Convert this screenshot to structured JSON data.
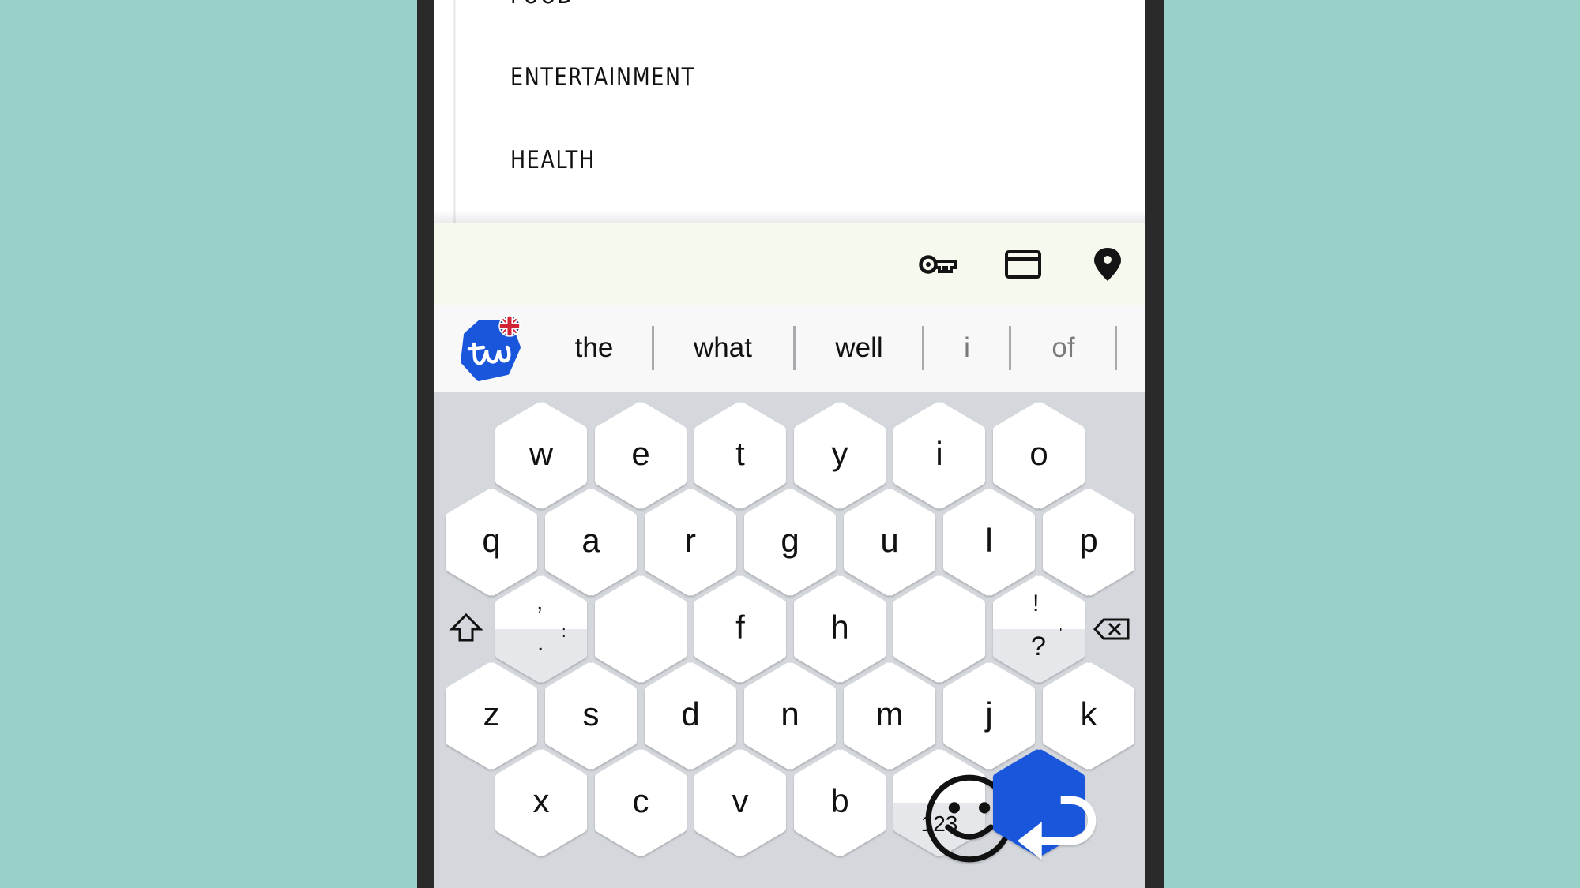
{
  "menu": {
    "items": [
      {
        "label": "FOOD"
      },
      {
        "label": "ENTERTAINMENT"
      },
      {
        "label": "HEALTH"
      }
    ]
  },
  "autofill": {
    "icons": [
      "key-icon",
      "credit-card-icon",
      "location-pin-icon"
    ]
  },
  "predictions": {
    "logo_text": "tw",
    "language_flag": "uk-flag",
    "suggestions": [
      {
        "text": "the",
        "dim": false
      },
      {
        "text": "what",
        "dim": false
      },
      {
        "text": "well",
        "dim": false
      },
      {
        "text": "i",
        "dim": true
      },
      {
        "text": "of",
        "dim": true
      }
    ]
  },
  "keyboard": {
    "rows": [
      [
        "w",
        "e",
        "t",
        "y",
        "i",
        "o"
      ],
      [
        "q",
        "a",
        "r",
        "g",
        "u",
        "l",
        "p"
      ],
      [
        "",
        "",
        "f",
        "h",
        "",
        ""
      ],
      [
        "z",
        "s",
        "d",
        "n",
        "m",
        "j",
        "k"
      ],
      [
        "x",
        "c",
        "v",
        "b"
      ]
    ],
    "punct_key": {
      "top": ",",
      "bottom": ".",
      "bottom_alt": ":"
    },
    "excl_key": {
      "top": "!",
      "bottom": "?",
      "bottom_alt": "'"
    },
    "emoji_key": {
      "top_icon": "emoji-icon",
      "bottom": "123"
    },
    "enter_color": "#1A56DB",
    "background_color": "#D4D7DC"
  },
  "colors": {
    "page_background": "#99D1C9",
    "autofill_background": "#F6F9EE"
  }
}
